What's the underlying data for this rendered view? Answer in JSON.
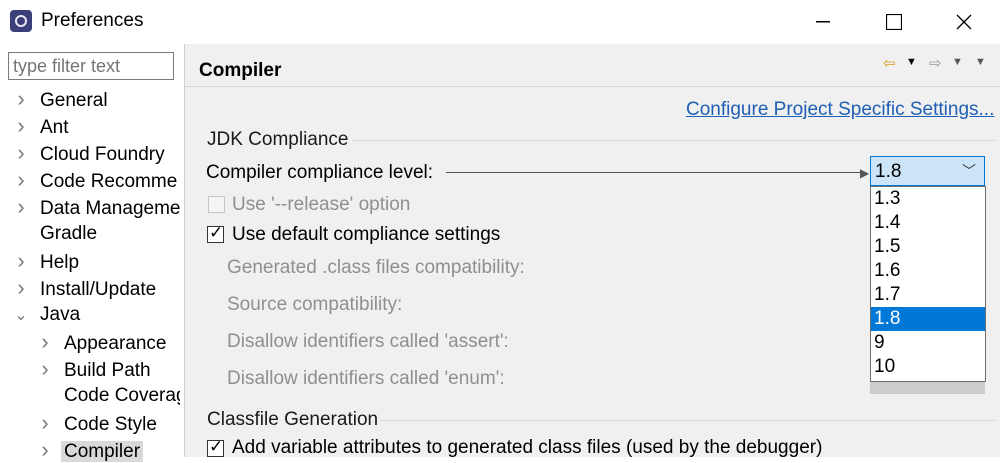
{
  "window": {
    "title": "Preferences"
  },
  "filter": {
    "placeholder": "type filter text"
  },
  "tree": [
    {
      "label": "General",
      "expandable": true,
      "expanded": false,
      "level": 0
    },
    {
      "label": "Ant",
      "expandable": true,
      "expanded": false,
      "level": 0
    },
    {
      "label": "Cloud Foundry",
      "expandable": true,
      "expanded": false,
      "level": 0
    },
    {
      "label": "Code Recomme",
      "expandable": true,
      "expanded": false,
      "level": 0
    },
    {
      "label": "Data Manageme",
      "expandable": true,
      "expanded": false,
      "level": 0
    },
    {
      "label": "Gradle",
      "expandable": false,
      "expanded": false,
      "level": 0
    },
    {
      "label": "Help",
      "expandable": true,
      "expanded": false,
      "level": 0
    },
    {
      "label": "Install/Update",
      "expandable": true,
      "expanded": false,
      "level": 0
    },
    {
      "label": "Java",
      "expandable": true,
      "expanded": true,
      "level": 0
    },
    {
      "label": "Appearance",
      "expandable": true,
      "expanded": false,
      "level": 1
    },
    {
      "label": "Build Path",
      "expandable": true,
      "expanded": false,
      "level": 1
    },
    {
      "label": "Code Coverag",
      "expandable": false,
      "expanded": false,
      "level": 1
    },
    {
      "label": "Code Style",
      "expandable": true,
      "expanded": false,
      "level": 1
    },
    {
      "label": "Compiler",
      "expandable": true,
      "expanded": false,
      "level": 1,
      "selected": true
    }
  ],
  "page": {
    "title": "Compiler",
    "configure_link": "Configure Project Specific Settings...",
    "jdk_group": "JDK Compliance",
    "compliance_label": "Compiler compliance level:",
    "compliance_value": "1.8",
    "release_option": "Use '--release' option",
    "use_default": "Use default compliance settings",
    "generated_label": "Generated .class files compatibility:",
    "source_label": "Source compatibility:",
    "assert_label": "Disallow identifiers called 'assert':",
    "enum_label": "Disallow identifiers called 'enum':",
    "classfile_group": "Classfile Generation",
    "add_var_attrs": "Add variable attributes to generated class files (used by the debugger)"
  },
  "dropdown_options": [
    "1.3",
    "1.4",
    "1.5",
    "1.6",
    "1.7",
    "1.8",
    "9",
    "10"
  ],
  "dropdown_selected": "1.8",
  "colors": {
    "accent": "#0078d7",
    "link": "#1f5fb5",
    "panel": "#f0f0f0"
  }
}
